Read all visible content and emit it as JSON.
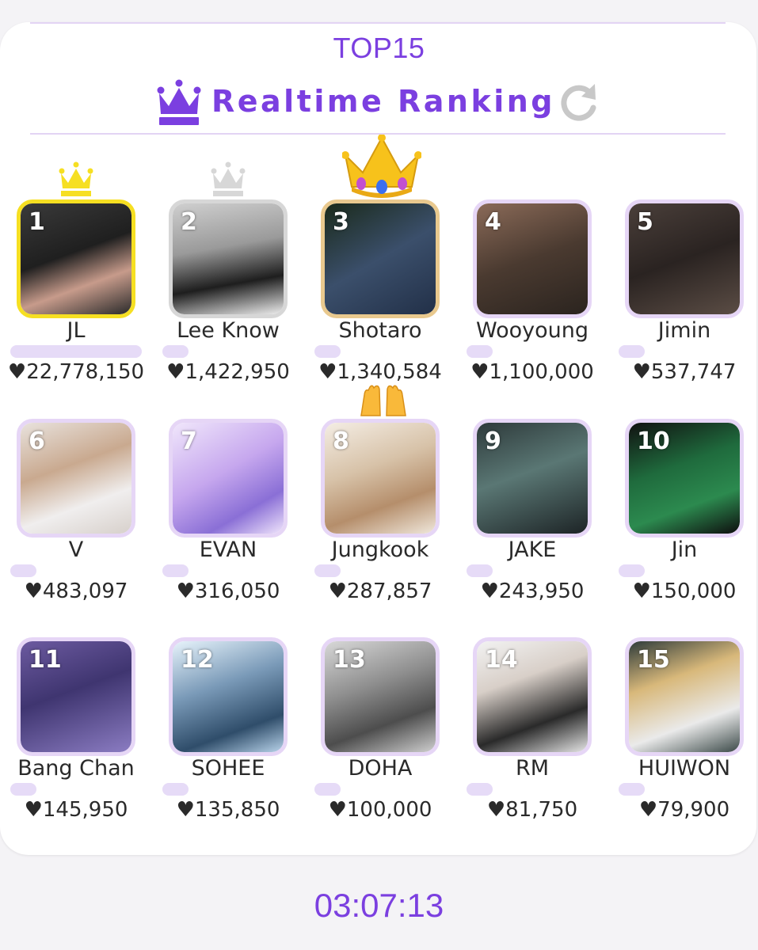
{
  "header": {
    "top_label": "TOP15",
    "title": "Realtime Ranking",
    "accent_color": "#7b3fe0",
    "title_icon": "crown-icon",
    "refresh_icon": "refresh-icon"
  },
  "ranking": [
    {
      "rank": "1",
      "name": "JL",
      "score": "♥22,778,150",
      "progress": 1.0,
      "badge": "gold-crown-icon"
    },
    {
      "rank": "2",
      "name": "Lee Know",
      "score": "♥1,422,950",
      "progress": 0.2,
      "badge": "silver-crown-icon"
    },
    {
      "rank": "3",
      "name": "Shotaro",
      "score": "♥1,340,584",
      "progress": 0.2,
      "badge": "crown-emoji-icon"
    },
    {
      "rank": "4",
      "name": "Wooyoung",
      "score": "♥1,100,000",
      "progress": 0.2
    },
    {
      "rank": "5",
      "name": "Jimin",
      "score": "♥537,747",
      "progress": 0.2
    },
    {
      "rank": "6",
      "name": "V",
      "score": "♥483,097",
      "progress": 0.2
    },
    {
      "rank": "7",
      "name": "EVAN",
      "score": "♥316,050",
      "progress": 0.2
    },
    {
      "rank": "8",
      "name": "Jungkook",
      "score": "♥287,857",
      "progress": 0.2,
      "badge": "raising-hands-icon"
    },
    {
      "rank": "9",
      "name": "JAKE",
      "score": "♥243,950",
      "progress": 0.2
    },
    {
      "rank": "10",
      "name": "Jin",
      "score": "♥150,000",
      "progress": 0.2
    },
    {
      "rank": "11",
      "name": "Bang Chan",
      "score": "♥145,950",
      "progress": 0.2
    },
    {
      "rank": "12",
      "name": "SOHEE",
      "score": "♥135,850",
      "progress": 0.2
    },
    {
      "rank": "13",
      "name": "DOHA",
      "score": "♥100,000",
      "progress": 0.2
    },
    {
      "rank": "14",
      "name": "RM",
      "score": "♥81,750",
      "progress": 0.2
    },
    {
      "rank": "15",
      "name": "HUIWON",
      "score": "♥79,900",
      "progress": 0.2
    }
  ],
  "colors": {
    "gold": "#f6df22",
    "silver": "#d7d7d7",
    "bronze": "#e9c98e",
    "frame": "#e6d6f6",
    "bar": "#e6dbf7"
  },
  "timer": "03:07:13"
}
